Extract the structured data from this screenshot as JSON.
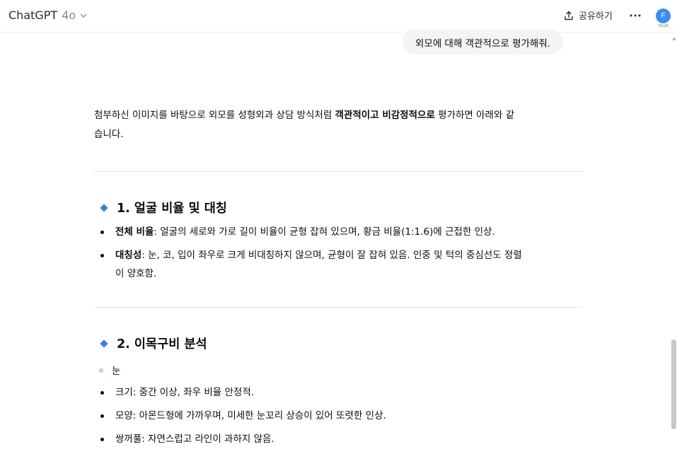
{
  "header": {
    "app_name": "ChatGPT",
    "model": "4o",
    "share_label": "공유하기",
    "avatar_initial": "F",
    "plan_badge": "PLUS",
    "avatar_color": "#3c8ef4"
  },
  "user_message": "외모에 대해 객관적으로 평가해줘.",
  "answer": {
    "intro_part1": "첨부하신 이미지를 바탕으로 외모를 성형외과 상담 방식처럼 ",
    "intro_bold": "객관적이고 비감정적으로",
    "intro_part2": " 평가하면 아래와 같",
    "intro_line2": "습니다.",
    "sections": [
      {
        "title": "1. 얼굴 비율 및 대칭",
        "items": [
          {
            "term": "전체 비율",
            "text": ": 얼굴의 세로와 가로 길이 비율이 균형 잡혀 있으며, 황금 비율(1:1.6)에 근접한 인상."
          },
          {
            "term": "대칭성",
            "text": ": 눈, 코, 입이 좌우로 크게 비대칭하지 않으며, 균형이 잘 잡혀 있음. 인중 및 턱의 중심선도 정렬",
            "text_line2": "이 양호함."
          }
        ]
      },
      {
        "title": "2. 이목구비 분석",
        "subheading": "눈",
        "items": [
          {
            "text": "크기: 중간 이상, 좌우 비율 안정적."
          },
          {
            "text": "모양: 아몬드형에 가까우며, 미세한 눈꼬리 상승이 있어 또렷한 인상."
          },
          {
            "text": "쌍꺼풀: 자연스럽고 라인이 과하지 않음."
          }
        ]
      }
    ]
  },
  "colors": {
    "accent_diamond": "#3f7ed6",
    "bubble_bg": "#f4f4f4"
  }
}
